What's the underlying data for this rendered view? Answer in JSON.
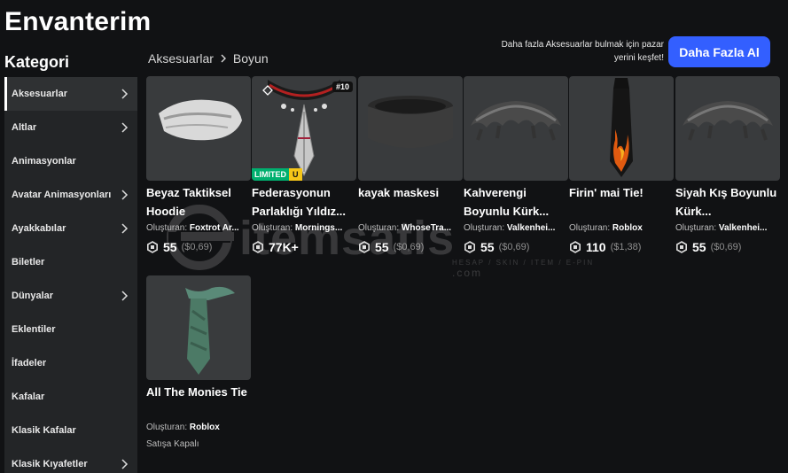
{
  "page": {
    "title": "Envanterim"
  },
  "sidebar": {
    "title": "Kategori",
    "items": [
      {
        "label": "Aksesuarlar",
        "chevron": true,
        "active": true
      },
      {
        "label": "Altlar",
        "chevron": true
      },
      {
        "label": "Animasyonlar",
        "chevron": false
      },
      {
        "label": "Avatar Animasyonları",
        "chevron": true
      },
      {
        "label": "Ayakkabılar",
        "chevron": true
      },
      {
        "label": "Biletler",
        "chevron": false
      },
      {
        "label": "Dünyalar",
        "chevron": true
      },
      {
        "label": "Eklentiler",
        "chevron": false
      },
      {
        "label": "İfadeler",
        "chevron": false
      },
      {
        "label": "Kafalar",
        "chevron": false
      },
      {
        "label": "Klasik Kafalar",
        "chevron": false
      },
      {
        "label": "Klasik Kıyafetler",
        "chevron": true
      }
    ]
  },
  "breadcrumb": {
    "parent": "Aksesuarlar",
    "current": "Boyun"
  },
  "promo": {
    "text": "Daha fazla Aksesuarlar bulmak için pazar yerini keşfet!",
    "button_label": "Daha Fazla Al"
  },
  "items": [
    {
      "name": "Beyaz Taktiksel Hoodie",
      "creator_prefix": "Oluşturan:",
      "creator": "Foxtrot Ar...",
      "price": "55",
      "usd": "($0,69)",
      "icon": "white-hood-icon"
    },
    {
      "name": "Federasyonun Parlaklığı Yıldız...",
      "creator_prefix": "Oluşturan:",
      "creator": "Mornings...",
      "price": "77K+",
      "usd": "",
      "limited_label": "LIMITED",
      "limited_u": "U",
      "serial": "#10",
      "icon": "star-pendant-icon"
    },
    {
      "name": "kayak maskesi",
      "creator_prefix": "Oluşturan:",
      "creator": "WhoseTra...",
      "price": "55",
      "usd": "($0,69)",
      "icon": "ski-mask-icon"
    },
    {
      "name": "Kahverengi Boyunlu Kürk...",
      "creator_prefix": "Oluşturan:",
      "creator": "Valkenhei...",
      "price": "55",
      "usd": "($0,69)",
      "icon": "fur-collar-icon"
    },
    {
      "name": "Firin' mai Tie!",
      "creator_prefix": "Oluşturan:",
      "creator": "Roblox",
      "price": "110",
      "usd": "($1,38)",
      "icon": "flame-tie-icon"
    },
    {
      "name": "Siyah Kış Boyunlu Kürk...",
      "creator_prefix": "Oluşturan:",
      "creator": "Valkenhei...",
      "price": "55",
      "usd": "($0,69)",
      "icon": "fur-collar-icon"
    },
    {
      "name": "All The Monies Tie",
      "creator_prefix": "Oluşturan:",
      "creator": "Roblox",
      "offsale": "Satışa Kapalı",
      "icon": "money-tie-icon"
    }
  ],
  "watermark": {
    "text": "itemsatis",
    "sub": "HESAP / SKIN / ITEM / E-PIN",
    "suffix": ".com"
  },
  "colors": {
    "accent": "#335fff",
    "limited": "#00b06f",
    "limited_u": "#f5c518",
    "tile": "#393b3d",
    "sidebar": "#232527",
    "background": "#111214"
  }
}
